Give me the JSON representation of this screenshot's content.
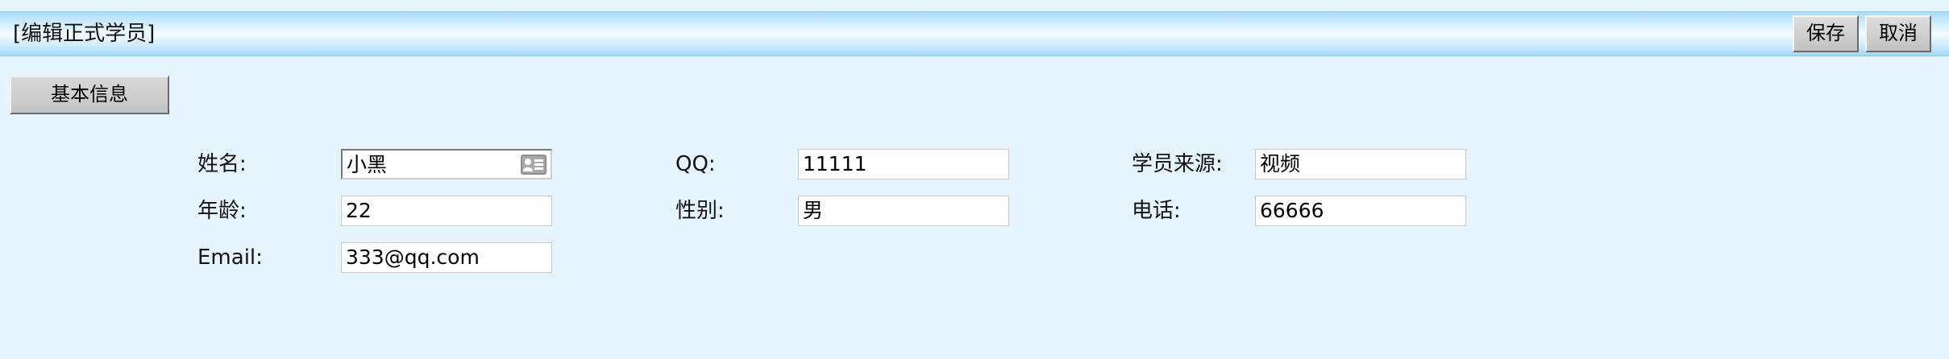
{
  "header": {
    "title": "[编辑正式学员]",
    "save_label": "保存",
    "cancel_label": "取消"
  },
  "section": {
    "tab_label": "基本信息"
  },
  "form": {
    "name": {
      "label": "姓名:",
      "value": "小黑",
      "icon": "contact-card-icon"
    },
    "qq": {
      "label": "QQ:",
      "value": "11111"
    },
    "source": {
      "label": "学员来源:",
      "value": "视频"
    },
    "age": {
      "label": "年龄:",
      "value": "22"
    },
    "gender": {
      "label": "性别:",
      "value": "男"
    },
    "phone": {
      "label": "电话:",
      "value": "66666"
    },
    "email": {
      "label": "Email:",
      "value": "333@qq.com"
    }
  }
}
